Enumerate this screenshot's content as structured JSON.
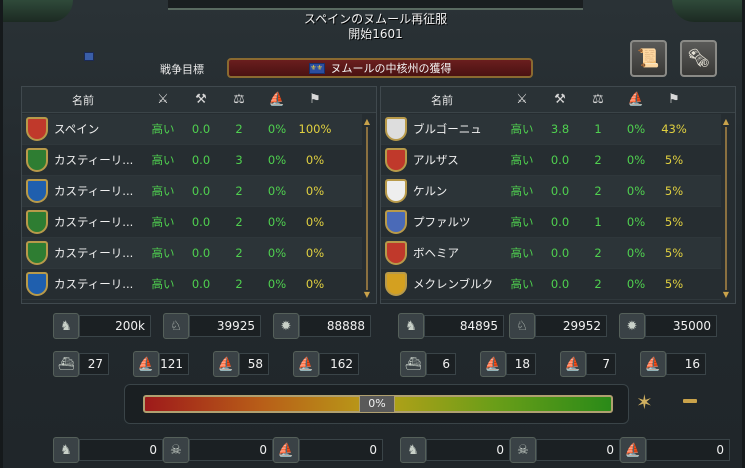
{
  "header": {
    "title": "スペインのヌムール再征服",
    "subtitle": "開始1601"
  },
  "goal": {
    "label": "戦争目標",
    "text": "ヌムールの中核州の獲得"
  },
  "columns": {
    "name": "名前"
  },
  "left": {
    "rows": [
      {
        "name": "スペイン",
        "a": "高い",
        "b": "0.0",
        "c": "2",
        "d": "0%",
        "e": "100%"
      },
      {
        "name": "カスティーリ...",
        "a": "高い",
        "b": "0.0",
        "c": "3",
        "d": "0%",
        "e": "0%"
      },
      {
        "name": "カスティーリ...",
        "a": "高い",
        "b": "0.0",
        "c": "2",
        "d": "0%",
        "e": "0%"
      },
      {
        "name": "カスティーリ...",
        "a": "高い",
        "b": "0.0",
        "c": "2",
        "d": "0%",
        "e": "0%"
      },
      {
        "name": "カスティーリ...",
        "a": "高い",
        "b": "0.0",
        "c": "2",
        "d": "0%",
        "e": "0%"
      },
      {
        "name": "カスティーリ...",
        "a": "高い",
        "b": "0.0",
        "c": "2",
        "d": "0%",
        "e": "0%"
      }
    ],
    "stats": {
      "inf": "200k",
      "cav": "39925",
      "art": "88888",
      "heavy": "27",
      "light": "121",
      "galley": "58",
      "transport": "162"
    },
    "losses": {
      "l1": "0",
      "l2": "0",
      "l3": "0"
    }
  },
  "right": {
    "rows": [
      {
        "name": "ブルゴーニュ",
        "a": "高い",
        "b": "3.8",
        "c": "1",
        "d": "0%",
        "e": "43%"
      },
      {
        "name": "アルザス",
        "a": "高い",
        "b": "0.0",
        "c": "2",
        "d": "0%",
        "e": "5%"
      },
      {
        "name": "ケルン",
        "a": "高い",
        "b": "0.0",
        "c": "2",
        "d": "0%",
        "e": "5%"
      },
      {
        "name": "プファルツ",
        "a": "高い",
        "b": "0.0",
        "c": "1",
        "d": "0%",
        "e": "5%"
      },
      {
        "name": "ボヘミア",
        "a": "高い",
        "b": "0.0",
        "c": "2",
        "d": "0%",
        "e": "5%"
      },
      {
        "name": "メクレンブルク",
        "a": "高い",
        "b": "0.0",
        "c": "2",
        "d": "0%",
        "e": "5%"
      }
    ],
    "stats": {
      "inf": "84895",
      "cav": "29952",
      "art": "35000",
      "heavy": "6",
      "light": "18",
      "galley": "7",
      "transport": "16"
    },
    "losses": {
      "l1": "0",
      "l2": "0",
      "l3": "0"
    }
  },
  "warscore": {
    "label": "0%",
    "value": 0
  },
  "colors": {
    "accent": "#c9a24a",
    "positive": "#4fd04f",
    "percent": "#e0d040"
  }
}
